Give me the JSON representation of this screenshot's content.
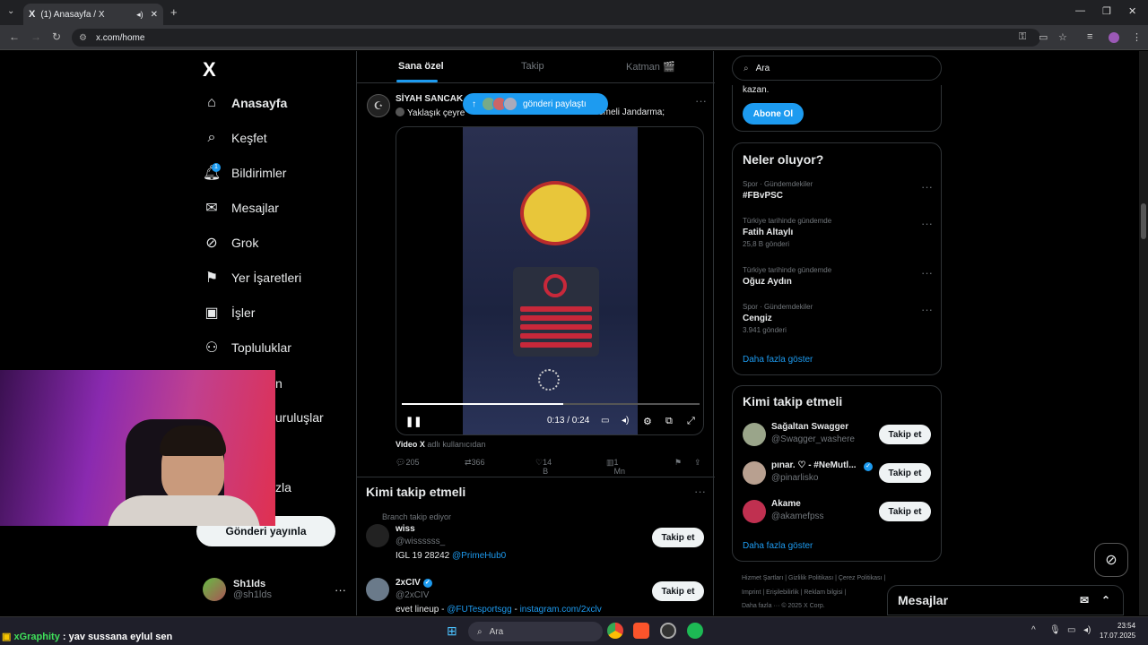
{
  "browser": {
    "tab_title": "(1) Anasayfa / X",
    "tab_logo": "X",
    "url": "x.com/home",
    "min_glyph": "—",
    "max_glyph": "❐",
    "close_glyph": "✕"
  },
  "nav": {
    "logo": "X",
    "items": [
      {
        "label": "Anasayfa",
        "icon": "home-icon",
        "glyph": "⌂"
      },
      {
        "label": "Keşfet",
        "icon": "search-icon",
        "glyph": "⌕"
      },
      {
        "label": "Bildirimler",
        "icon": "bell-icon",
        "glyph": "🔔︎",
        "badge": "1"
      },
      {
        "label": "Mesajlar",
        "icon": "mail-icon",
        "glyph": "✉"
      },
      {
        "label": "Grok",
        "icon": "grok-icon",
        "glyph": "⊘"
      },
      {
        "label": "Yer İşaretleri",
        "icon": "bookmark-icon",
        "glyph": "⚑"
      },
      {
        "label": "İşler",
        "icon": "briefcase-icon",
        "glyph": "▣"
      },
      {
        "label": "Topluluklar",
        "icon": "people-icon",
        "glyph": "⚇"
      }
    ],
    "partial_1": "n",
    "partial_2": "uruluşlar",
    "partial_3": "zla",
    "post_button": "Gönderi yayınla",
    "account": {
      "name": "Sh1lds",
      "handle": "@sh1lds",
      "more": "···"
    }
  },
  "timeline": {
    "tabs": [
      "Sana özel",
      "Takip",
      "Katman 🎬"
    ],
    "tweet": {
      "author": "SİYAH SANCAK",
      "text_left": "Yaklaşık çeyre",
      "text_right": "ademeli Jandarma;",
      "share_pill": "gönderi paylaştı",
      "video_time": "0:13 / 0:24",
      "video_source_name": "Video X",
      "video_source_suffix": "adlı kullanıcıdan",
      "replies": "205",
      "reposts": "366",
      "likes": "14 B",
      "views": "1 Mn",
      "more": "···"
    },
    "who_to_follow": {
      "title": "Kimi takip etmeli",
      "more": "···",
      "subtitle": "Branch takip ediyor",
      "users": [
        {
          "name": "wiss",
          "handle": "@wissssss_",
          "bio_text": "IGL 19 28242 ",
          "bio_link": "@PrimeHub0",
          "button": "Takip et"
        },
        {
          "name": "2xCIV",
          "handle": "@2xCIV",
          "bio_text": "evet lineup - ",
          "bio_link": "@FUTesportsgg",
          "bio_mid": " - ",
          "bio_link2": "instagram.com/2xclv",
          "button": "Takip et",
          "verified": true
        }
      ]
    }
  },
  "right": {
    "search_placeholder": "Ara",
    "premium": {
      "text": "kazan.",
      "button": "Abone Ol"
    },
    "trends": {
      "title": "Neler oluyor?",
      "items": [
        {
          "context": "Spor · Gündemdekiler",
          "name": "#FBvPSC",
          "posts": ""
        },
        {
          "context": "Türkiye tarihinde gündemde",
          "name": "Fatih Altaylı",
          "posts": "25,8 B gönderi"
        },
        {
          "context": "Türkiye tarihinde gündemde",
          "name": "Oğuz Aydın",
          "posts": ""
        },
        {
          "context": "Spor · Gündemdekiler",
          "name": "Cengiz",
          "posts": "3.941 gönderi"
        }
      ],
      "more_glyph": "···",
      "show_more": "Daha fazla göster"
    },
    "who_to_follow": {
      "title": "Kimi takip etmeli",
      "users": [
        {
          "name": "Sağaltan Swagger",
          "handle": "@Swagger_washere",
          "button": "Takip et"
        },
        {
          "name": "pınar. ♡ - #NeMutl...",
          "handle": "@pinarlisko",
          "button": "Takip et",
          "verified": true
        },
        {
          "name": "Akame",
          "handle": "@akamefpss",
          "button": "Takip et"
        }
      ],
      "show_more": "Daha fazla göster"
    },
    "footer": {
      "row1": "Hizmet Şartları  |  Gizlilik Politikası  |  Çerez Politikası  |",
      "row2": "Imprint  |  Erişilebilirlik  |  Reklam bilgisi  |",
      "row3": "Daha fazla ···   © 2025 X Corp."
    },
    "messages_label": "Mesajlar"
  },
  "taskbar": {
    "chat_user": "xGraphity",
    "chat_text": " : yav sussana eylul sen",
    "search": "Ara",
    "time": "23:54",
    "date": "17.07.2025"
  },
  "colors": {
    "accent": "#1d9bf0",
    "bg": "#000000",
    "text": "#e7e9ea",
    "muted": "#71767b"
  }
}
